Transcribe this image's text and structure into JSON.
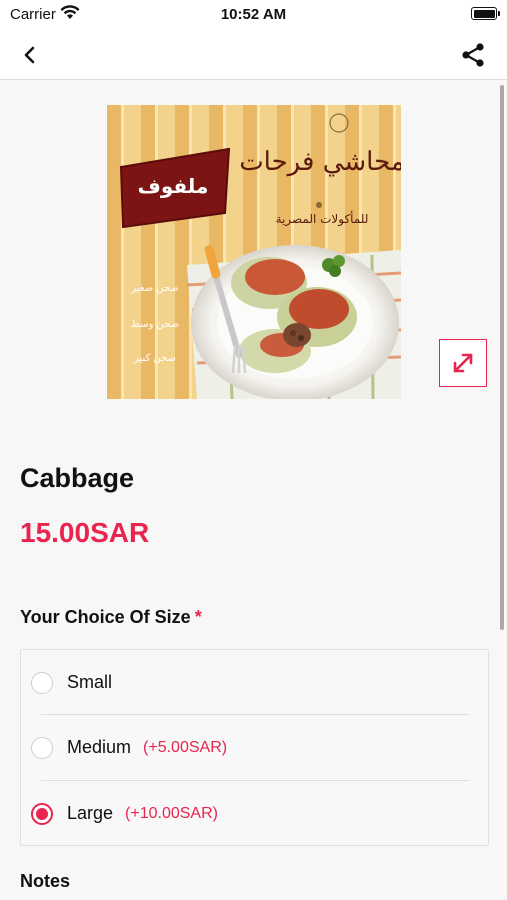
{
  "status_bar": {
    "carrier": "Carrier",
    "time": "10:52 AM"
  },
  "nav": {
    "back_icon": "chevron-left-icon",
    "share_icon": "share-icon"
  },
  "product": {
    "image": {
      "brand_logo_text": "محاشي فرحات",
      "brand_tagline": "للمأكولات المصرية",
      "dish_label": "ملفوف",
      "size_labels": [
        "صحن صغير",
        "صحن وسط",
        "صحن كبير"
      ]
    },
    "expand_icon": "expand-arrows-icon",
    "name": "Cabbage",
    "price": "15.00SAR"
  },
  "size_section": {
    "title": "Your Choice Of Size",
    "required_mark": "*",
    "options": [
      {
        "label": "Small",
        "extra": "",
        "selected": false
      },
      {
        "label": "Medium",
        "extra": "(+5.00SAR)",
        "selected": false
      },
      {
        "label": "Large",
        "extra": "(+10.00SAR)",
        "selected": true
      }
    ]
  },
  "notes": {
    "title": "Notes"
  },
  "colors": {
    "accent": "#e8244f",
    "banner": "#7c1414"
  }
}
